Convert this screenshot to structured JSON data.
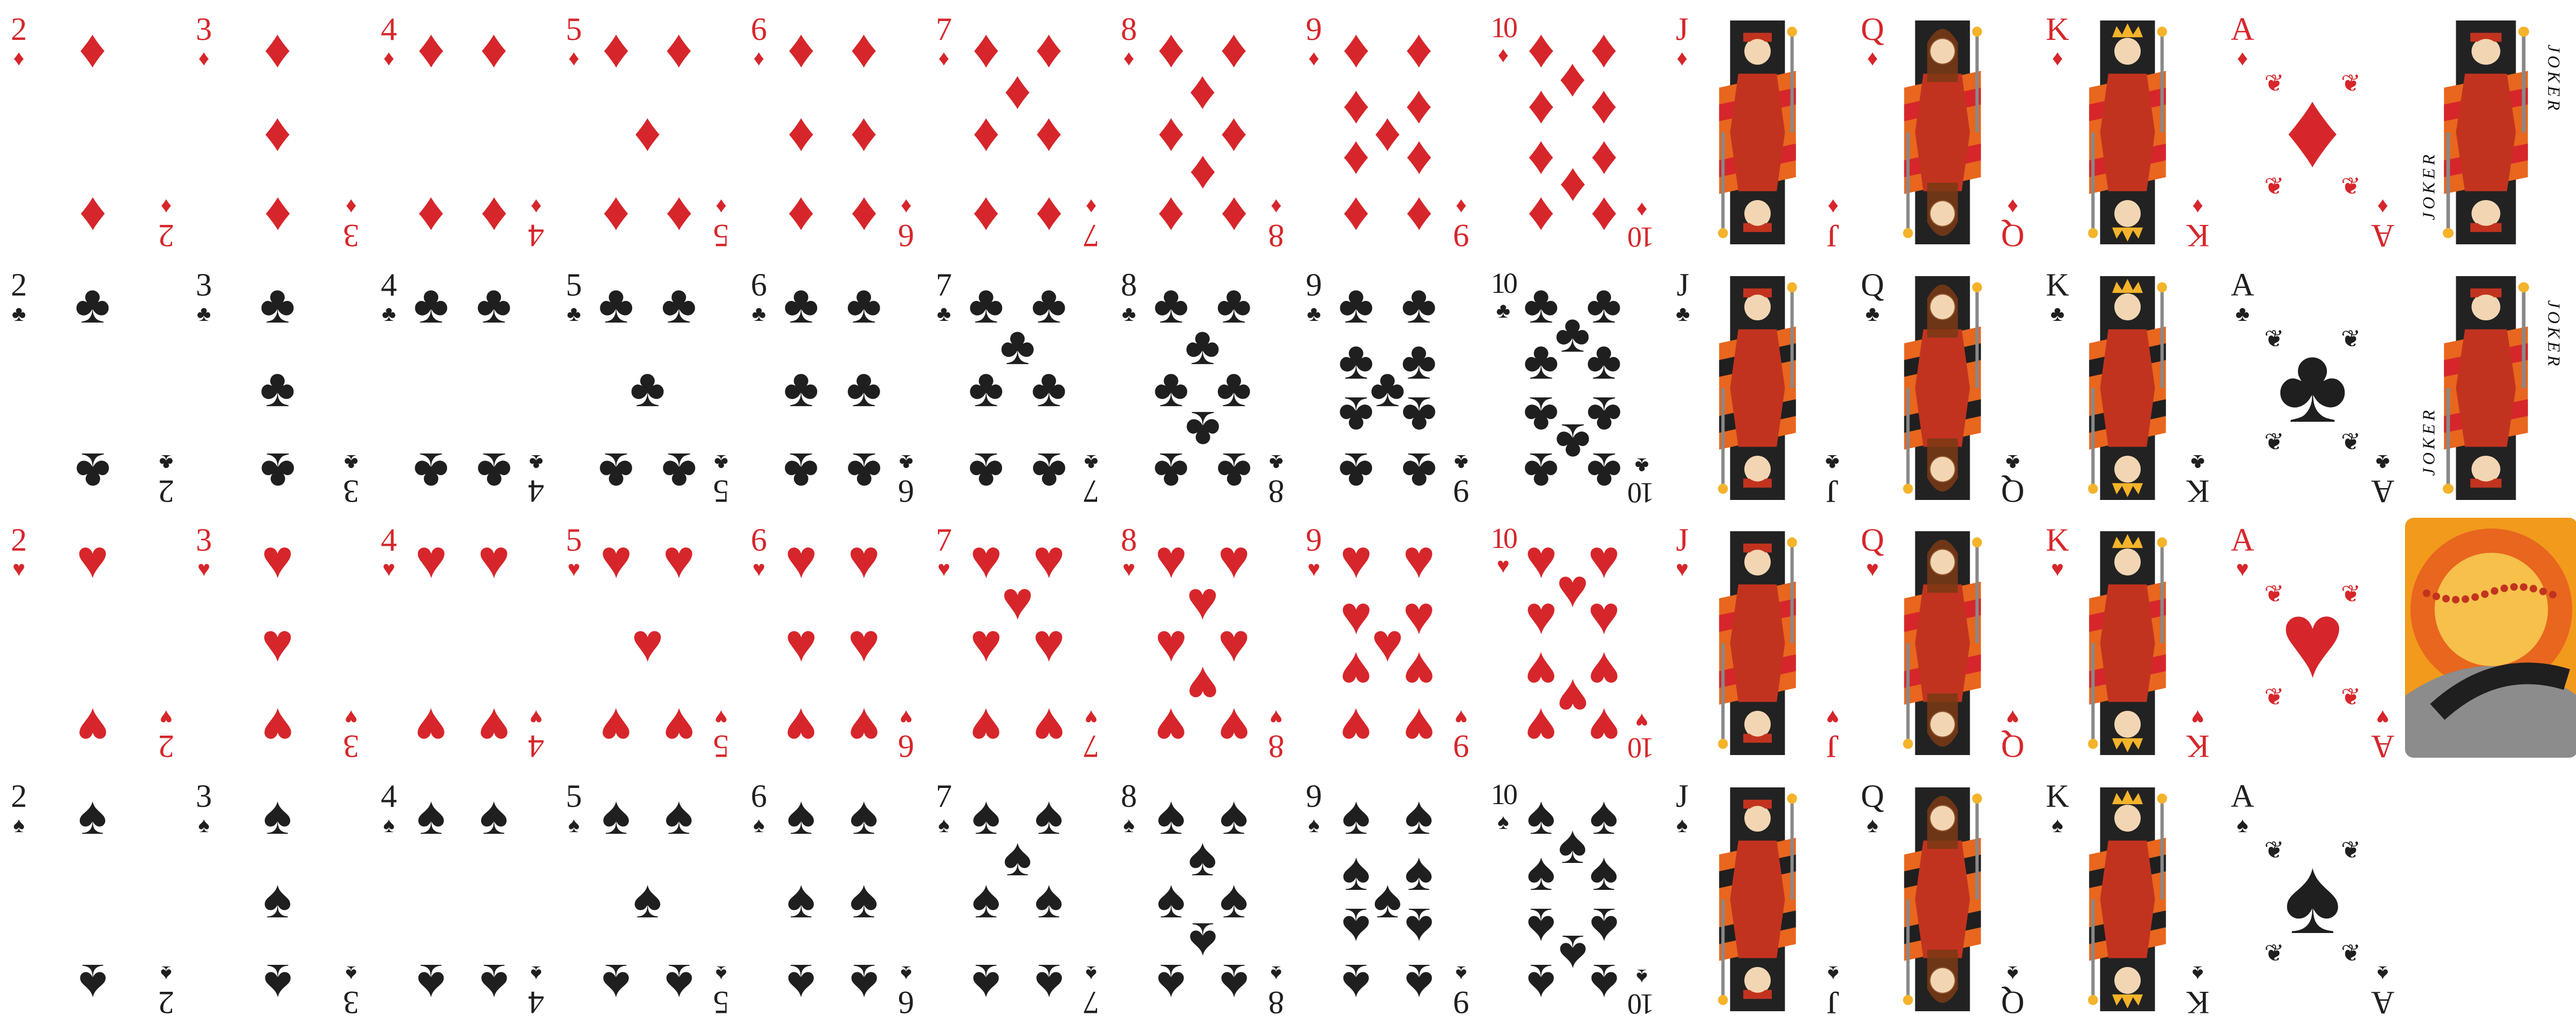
{
  "colors": {
    "red": "#d6262b",
    "black": "#1f1f1f",
    "background": "#ffffff",
    "face_accent": "#e8661e",
    "face_gold": "#f4b32a"
  },
  "suits": [
    {
      "name": "diamonds",
      "symbol": "♦",
      "color": "#d6262b",
      "ace_ornament": "diamond-ornament"
    },
    {
      "name": "clubs",
      "symbol": "♣",
      "color": "#1f1f1f",
      "ace_ornament": "club-ornament"
    },
    {
      "name": "hearts",
      "symbol": "♥",
      "color": "#d6262b",
      "ace_ornament": "heart-ornament"
    },
    {
      "name": "spades",
      "symbol": "♠",
      "color": "#1f1f1f",
      "ace_ornament": "spade-ornament"
    }
  ],
  "ranks": [
    "2",
    "3",
    "4",
    "5",
    "6",
    "7",
    "8",
    "9",
    "10",
    "J",
    "Q",
    "K",
    "A"
  ],
  "face_ranks": [
    "J",
    "Q",
    "K"
  ],
  "extras": [
    {
      "row": 0,
      "type": "joker",
      "text": "JOKER"
    },
    {
      "row": 1,
      "type": "joker",
      "text": "JOKER"
    },
    {
      "row": 2,
      "type": "card-back",
      "icon": "card-back-pattern"
    }
  ]
}
